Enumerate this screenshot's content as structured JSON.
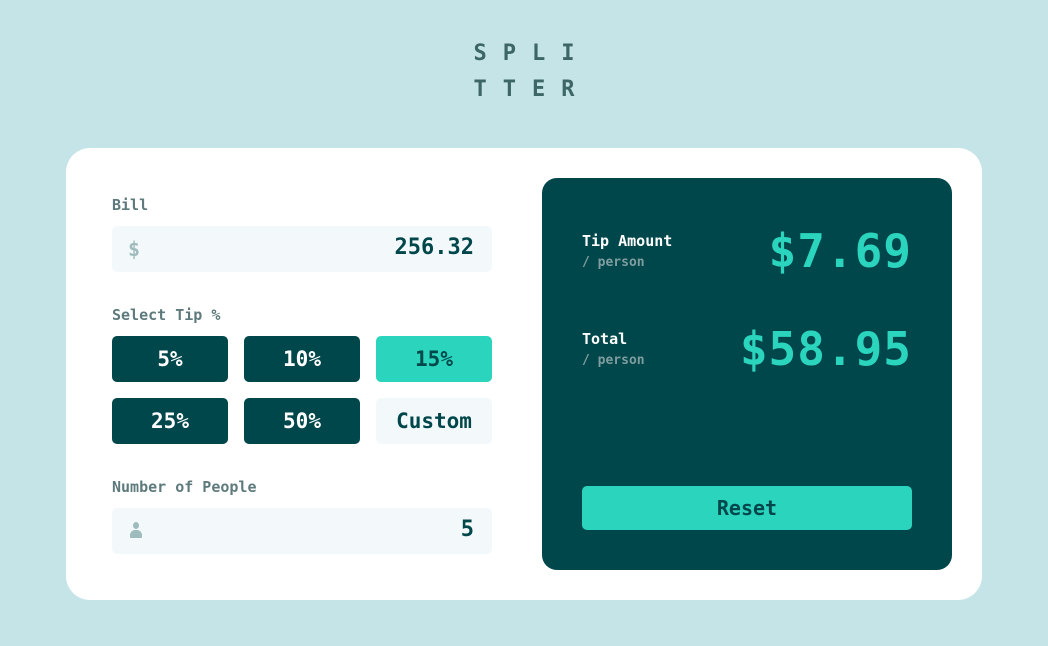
{
  "logo": {
    "line1": "SPLI",
    "line2": "TTER"
  },
  "bill": {
    "label": "Bill",
    "currency_icon": "$",
    "value": "256.32"
  },
  "tip": {
    "label": "Select Tip %",
    "options": [
      "5%",
      "10%",
      "15%",
      "25%",
      "50%"
    ],
    "selected": "15%",
    "custom_label": "Custom"
  },
  "people": {
    "label": "Number of People",
    "icon": "person-icon",
    "value": "5"
  },
  "results": {
    "tip_title": "Tip Amount",
    "tip_sub": "/ person",
    "tip_amount": "$7.69",
    "total_title": "Total",
    "total_sub": "/ person",
    "total_amount": "$58.95",
    "reset_label": "Reset"
  },
  "colors": {
    "background": "#c5e4e7",
    "dark": "#00474b",
    "accent": "#2ad4bd",
    "field": "#f3f9fa"
  }
}
